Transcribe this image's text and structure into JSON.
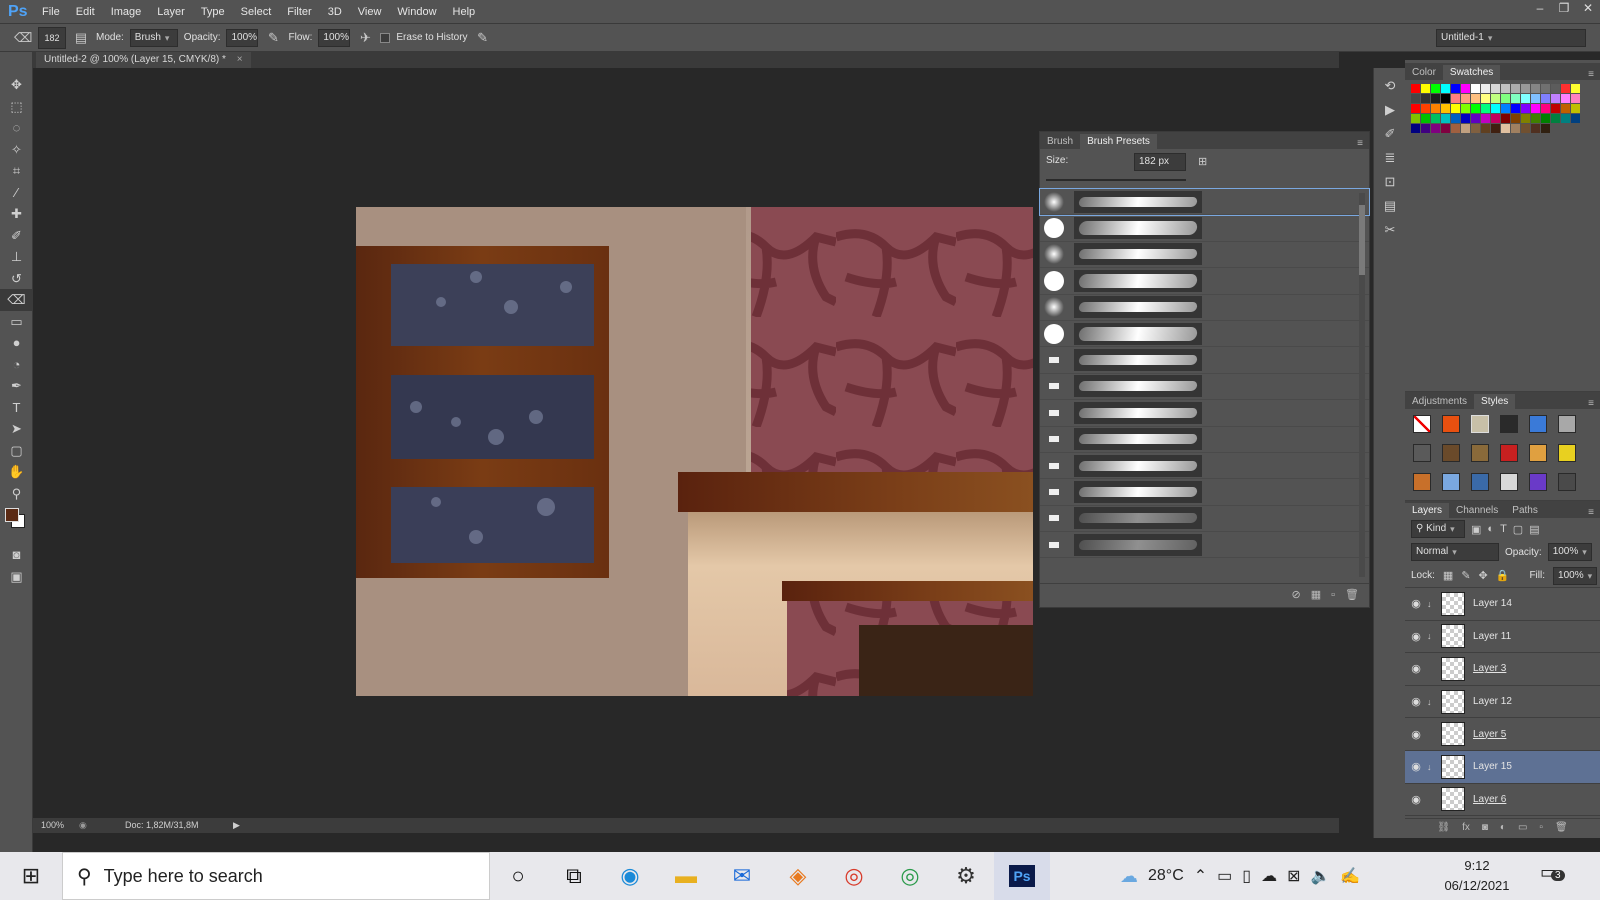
{
  "app": {
    "logo": "Ps",
    "menu": [
      "File",
      "Edit",
      "Image",
      "Layer",
      "Type",
      "Select",
      "Filter",
      "3D",
      "View",
      "Window",
      "Help"
    ]
  },
  "options_bar": {
    "brush_size": "182",
    "mode_label": "Mode:",
    "mode_value": "Brush",
    "opacity_label": "Opacity:",
    "opacity_value": "100%",
    "flow_label": "Flow:",
    "flow_value": "100%",
    "erase_history_label": "Erase to History",
    "workspace": "Untitled-1"
  },
  "document": {
    "tab_title": "Untitled-2 @ 100% (Layer 15, CMYK/8) *",
    "zoom": "100%",
    "doc_size": "Doc: 1,82M/31,8M"
  },
  "brush_panel": {
    "tabs": [
      "Brush",
      "Brush Presets"
    ],
    "size_label": "Size:",
    "size_value": "182 px"
  },
  "color_panel": {
    "tabs": [
      "Color",
      "Swatches"
    ]
  },
  "adjust_panel": {
    "tabs": [
      "Adjustments",
      "Styles"
    ]
  },
  "layers_panel": {
    "tabs": [
      "Layers",
      "Channels",
      "Paths"
    ],
    "kind_label": "Kind",
    "blend_mode": "Normal",
    "opacity_label": "Opacity:",
    "opacity_value": "100%",
    "lock_label": "Lock:",
    "fill_label": "Fill:",
    "fill_value": "100%",
    "layers": [
      {
        "name": "Layer 14",
        "selected": false,
        "linked": true
      },
      {
        "name": "Layer 11",
        "selected": false,
        "linked": true
      },
      {
        "name": "Layer 3",
        "selected": false,
        "linked": false
      },
      {
        "name": "Layer 12",
        "selected": false,
        "linked": true
      },
      {
        "name": "Layer 5",
        "selected": false,
        "linked": false
      },
      {
        "name": "Layer 15",
        "selected": true,
        "linked": true
      },
      {
        "name": "Layer 6",
        "selected": false,
        "linked": false
      }
    ]
  },
  "taskbar": {
    "search_placeholder": "Type here to search",
    "weather": "28°C",
    "time": "9:12",
    "date": "06/12/2021",
    "notifications": "3"
  },
  "colors": {
    "foreground": "#5a2a14",
    "background": "#ffffff",
    "selected_layer": "#5e7194"
  }
}
